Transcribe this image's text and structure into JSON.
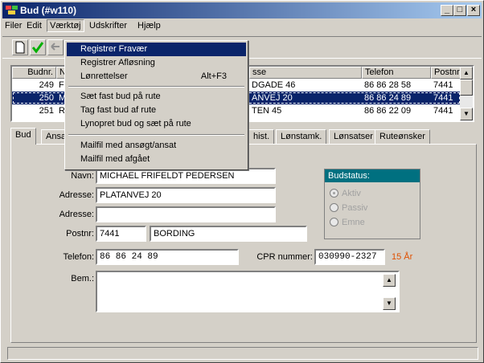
{
  "window": {
    "title": "Bud (#w110)"
  },
  "menubar": [
    "Filer",
    "Edit",
    "Værktøj",
    "Udskrifter",
    "Hjælp"
  ],
  "grid": {
    "headers": [
      "Budnr.",
      "N",
      "sse",
      "Telefon",
      "Postnr"
    ],
    "rows": [
      {
        "budnr": "249",
        "navn": "F",
        "adresse": "DGADE 46",
        "telefon": "86 86 28 58",
        "postnr": "7441"
      },
      {
        "budnr": "250",
        "navn": "M",
        "adresse": "ANVEJ 20",
        "telefon": "86 86 24 89",
        "postnr": "7441"
      },
      {
        "budnr": "251",
        "navn": "R",
        "adresse": "TEN 45",
        "telefon": "86 86 22 09",
        "postnr": "7441"
      }
    ]
  },
  "tabs": [
    "Bud",
    "Ansa",
    "hist.",
    "Lønstamk.",
    "Lønsatser",
    "Ruteønsker"
  ],
  "form": {
    "navn_label": "Navn:",
    "navn": "MICHAEL FRIFELDT PEDERSEN",
    "adresse_label": "Adresse:",
    "adresse": "PLATANVEJ 20",
    "adresse2_label": "Adresse:",
    "adresse2": "",
    "postnr_label": "Postnr:",
    "postnr": "7441",
    "by": "BORDING",
    "telefon_label": "Telefon:",
    "telefon": "86 86 24 89",
    "cpr_label": "CPR nummer:",
    "cpr": "030990-2327",
    "age": "15 År",
    "bem_label": "Bem.:",
    "bem": ""
  },
  "budstatus": {
    "title": "Budstatus:",
    "options": [
      {
        "label": "Aktiv",
        "selected": true
      },
      {
        "label": "Passiv",
        "selected": false
      },
      {
        "label": "Emne",
        "selected": false
      }
    ]
  },
  "dropdown": {
    "items": [
      {
        "label": "Registrer Fravær",
        "shortcut": "",
        "highlighted": true
      },
      {
        "label": "Registrer Afløsning",
        "shortcut": ""
      },
      {
        "label": "Lønrettelser",
        "shortcut": "Alt+F3"
      },
      {
        "label": "Sæt fast bud på rute",
        "shortcut": ""
      },
      {
        "label": "Tag fast bud af rute",
        "shortcut": ""
      },
      {
        "label": "Lynopret bud og sæt på rute",
        "shortcut": ""
      },
      {
        "label": "Mailfil med ansøgt/ansat",
        "shortcut": ""
      },
      {
        "label": "Mailfil med afgået",
        "shortcut": ""
      }
    ]
  },
  "colors": {
    "title_bar": "#0a246a",
    "selection": "#0a246a",
    "budstatus_header": "#007080",
    "age": "#e05000"
  }
}
